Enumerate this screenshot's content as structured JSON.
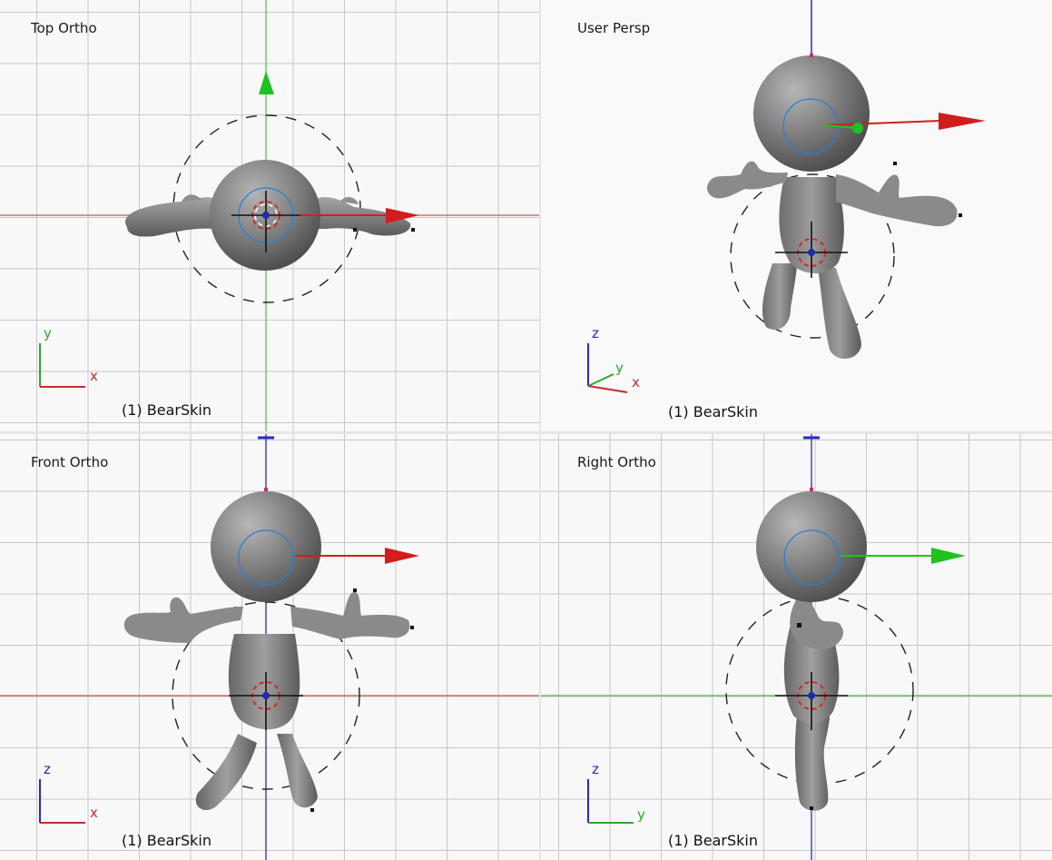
{
  "viewports": {
    "top": {
      "title": "Top Ortho",
      "object": "(1) BearSkin",
      "axes": [
        "y",
        "x"
      ]
    },
    "persp": {
      "title": "User Persp",
      "object": "(1) BearSkin",
      "axes": [
        "z",
        "y",
        "x"
      ]
    },
    "front": {
      "title": "Front Ortho",
      "object": "(1) BearSkin",
      "axes": [
        "z",
        "x"
      ]
    },
    "right": {
      "title": "Right Ortho",
      "object": "(1) BearSkin",
      "axes": [
        "z",
        "y"
      ]
    }
  },
  "colors": {
    "axis_x": "#cc2a2a",
    "axis_y": "#28b828",
    "axis_z": "#2828c8",
    "mesh": "#8a8a8a",
    "grid": "#c8c8c8"
  }
}
